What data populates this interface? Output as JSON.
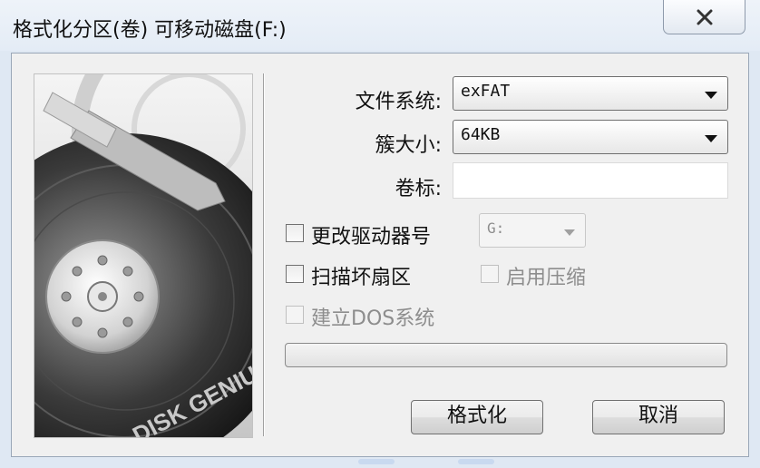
{
  "window": {
    "title": "格式化分区(卷) 可移动磁盘(F:)"
  },
  "image": {
    "brand_text": "DISK GENIUS"
  },
  "form": {
    "filesystem": {
      "label": "文件系统:",
      "value": "exFAT"
    },
    "cluster": {
      "label": "簇大小:",
      "value": "64KB"
    },
    "volume_label": {
      "label": "卷标:",
      "value": ""
    },
    "change_drive": {
      "label": "更改驱动器号",
      "checked": false,
      "drive_value": "G:"
    },
    "scan_bad": {
      "label": "扫描坏扇区",
      "checked": false
    },
    "compress": {
      "label": "启用压缩",
      "checked": false,
      "enabled": false
    },
    "dos_system": {
      "label": "建立DOS系统",
      "checked": false,
      "enabled": false
    },
    "progress": {
      "fraction": 0
    }
  },
  "buttons": {
    "format_label": "格式化",
    "cancel_label": "取消"
  },
  "colors": {
    "title_bg": "#e4ecf6",
    "dialog_bg": "#f0f0f0",
    "progress_fill": "#06b025"
  }
}
